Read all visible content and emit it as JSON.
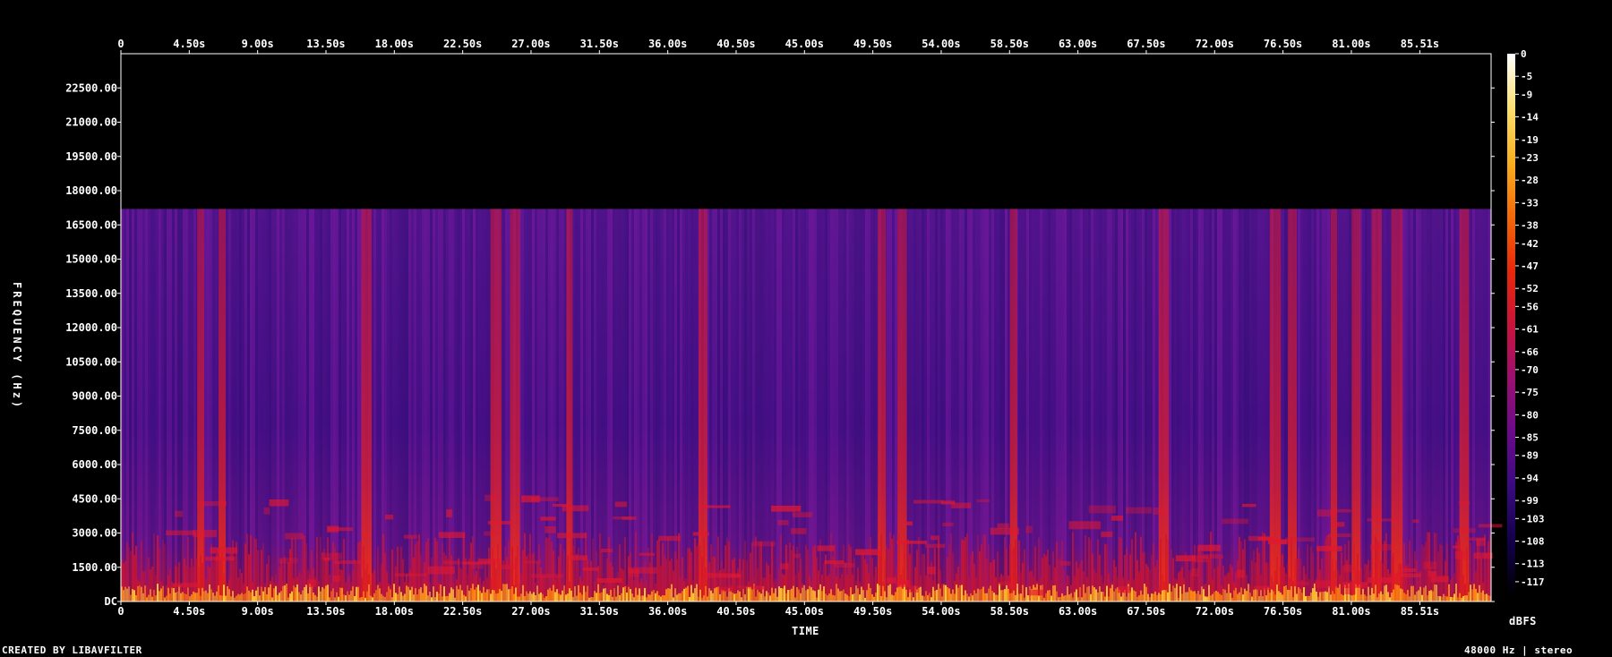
{
  "chart_data": {
    "type": "heatmap",
    "subtype": "spectrogram",
    "xlabel": "TIME",
    "ylabel": "FREQUENCY (Hz)",
    "x_ticks": [
      "0",
      "4.50s",
      "9.00s",
      "13.50s",
      "18.00s",
      "22.50s",
      "27.00s",
      "31.50s",
      "36.00s",
      "40.50s",
      "45.00s",
      "49.50s",
      "54.00s",
      "58.50s",
      "63.00s",
      "67.50s",
      "72.00s",
      "76.50s",
      "81.00s",
      "85.51s"
    ],
    "x_tick_values": [
      0,
      4.5,
      9,
      13.5,
      18,
      22.5,
      27,
      31.5,
      36,
      40.5,
      45,
      49.5,
      54,
      58.5,
      63,
      67.5,
      72,
      76.5,
      81,
      85.51
    ],
    "xlim": [
      0,
      90.2
    ],
    "y_ticks": [
      "DC",
      "1500.00",
      "3000.00",
      "4500.00",
      "6000.00",
      "7500.00",
      "9000.00",
      "10500.00",
      "12000.00",
      "13500.00",
      "15000.00",
      "16500.00",
      "18000.00",
      "19500.00",
      "21000.00",
      "22500.00"
    ],
    "y_tick_values": [
      0,
      1500,
      3000,
      4500,
      6000,
      7500,
      9000,
      10500,
      12000,
      13500,
      15000,
      16500,
      18000,
      19500,
      21000,
      22500
    ],
    "ylim": [
      0,
      24000
    ],
    "content_cutoff_hz": 17200,
    "colorbar": {
      "label": "dBFS",
      "ticks": [
        "0",
        "-5",
        "-9",
        "-14",
        "-19",
        "-23",
        "-28",
        "-33",
        "-38",
        "-42",
        "-47",
        "-52",
        "-56",
        "-61",
        "-66",
        "-70",
        "-75",
        "-80",
        "-85",
        "-89",
        "-94",
        "-99",
        "-103",
        "-108",
        "-113",
        "-117"
      ],
      "tick_values": [
        0,
        -5,
        -9,
        -14,
        -19,
        -23,
        -28,
        -33,
        -38,
        -42,
        -47,
        -52,
        -56,
        -61,
        -66,
        -70,
        -75,
        -80,
        -85,
        -89,
        -94,
        -99,
        -103,
        -108,
        -113,
        -117
      ],
      "range": [
        -120,
        0
      ],
      "colors": [
        "#000000",
        "#12004a",
        "#3a0a80",
        "#6a0a8a",
        "#9a1070",
        "#c8143a",
        "#e8280a",
        "#f46a0a",
        "#f8b020",
        "#fce070",
        "#ffffff"
      ]
    },
    "loud_bands_s": [
      5.2,
      6.6,
      16.0,
      24.5,
      25.8,
      29.5,
      38.2,
      50.0,
      51.3,
      58.7,
      68.5,
      75.8,
      77.0,
      79.8,
      81.2,
      82.5,
      83.8,
      88.3
    ],
    "grid": false,
    "legend": "colorbar-right"
  },
  "footer": {
    "left": "CREATED BY LIBAVFILTER",
    "right": "48000 Hz | stereo"
  }
}
